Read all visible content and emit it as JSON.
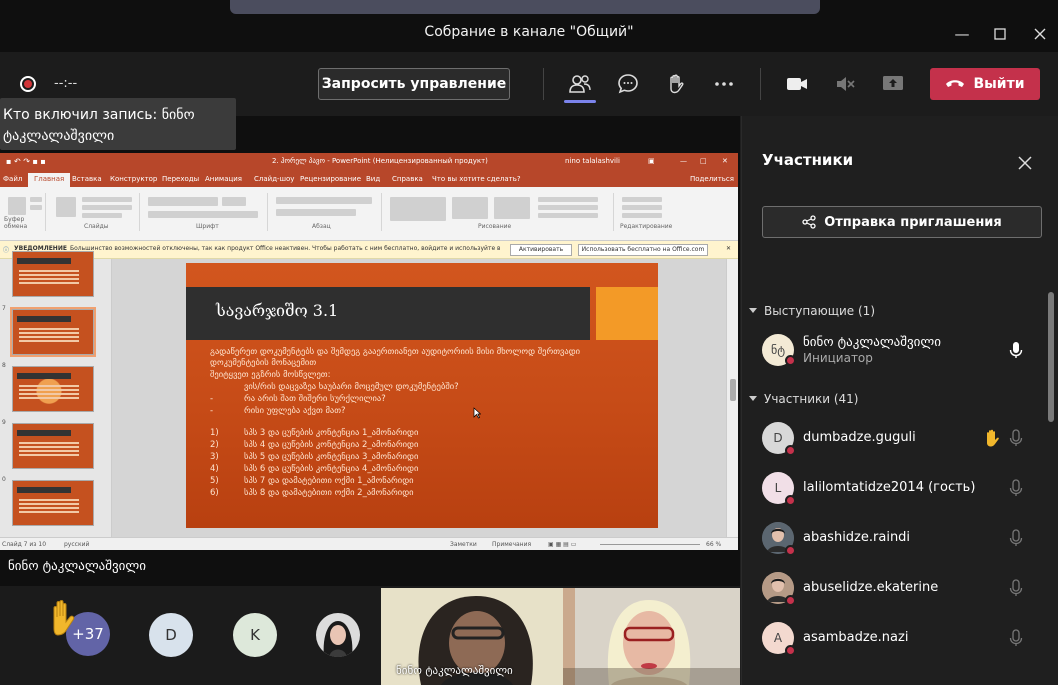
{
  "window": {
    "title": "Собрание в канале \"Общий\""
  },
  "toolbar": {
    "timer": "--:--",
    "request_control_label": "Запросить управление",
    "leave_label": "Выйти",
    "accent": "#7b83eb",
    "leave_color": "#c4314b"
  },
  "recording_tip": {
    "line1": "Кто включил запись: ნინო",
    "line2": "ტაკლალაშვილი"
  },
  "ppt": {
    "window_title": "2. ჰორელ პავო - PowerPoint (Нелицензированный продукт)",
    "user": "nino talalashvili",
    "tabs": [
      "Файл",
      "Главная",
      "Вставка",
      "Конструктор",
      "Переходы",
      "Анимация",
      "Слайд-шоу",
      "Рецензирование",
      "Вид",
      "Справка",
      "Что вы хотите сделать?"
    ],
    "share_label": "Поделиться",
    "ribbon_groups": [
      "Буфер обмена",
      "Слайды",
      "Шрифт",
      "Абзац",
      "Рисование",
      "Редактирование"
    ],
    "notice_label": "УВЕДОМЛЕНИЕ",
    "notice_text": "Большинство возможностей отключены, так как продукт Office неактивен. Чтобы работать с ним бесплатно, войдите и используйте веб-версию.",
    "activate_btn": "Активировать",
    "free_btn": "Использовать бесплатно на Office.com",
    "thumb_numbers": [
      "7",
      "8",
      "9",
      "0"
    ],
    "slide_title": "სავარჯიშო 3.1",
    "slide_lines": [
      "გადაწერეთ დოკუმენტებს და შემდეგ გააერთიანეთ აუდიტორიის მისი მხოლოდ შერთვადი",
      "დოკუმენტების მონაცემით",
      "შეიტყვეთ ეგზრის მოსწვლეთ:",
      "ვის/რის დაცვაზეა ხაუბარი მოცემულ დოკუმენტებში?",
      "რა არის შათ შიშერი სურქლილია?",
      "რისი უფლება აქვთ მათ?"
    ],
    "slide_bullets": [
      "-",
      "-"
    ],
    "slide_numbers": [
      "1)",
      "2)",
      "3)",
      "4)",
      "5)",
      "6)"
    ],
    "slide_items": [
      "სპს 3 და ცუწების კონტენცია 1_ამონარიდი",
      "სპს 4 და ცუწების კონტენცია 2_ამონარიდი",
      "სპს 5 და ცუწების კონტენცია 3_ამონარიდი",
      "სპს 6 და ცუწების კონტენცია 4_ამონარიდი",
      "სპს 7 და დამატებითი ოქმი 1_ამონარიდი",
      "სპს 8 და დამატებითი ოქმი 2_ამონარიდი"
    ],
    "status_slide": "Слайд 7 из 10",
    "status_lang": "русский",
    "status_notes": "Заметки",
    "status_comments": "Примечания",
    "status_zoom": "66 %"
  },
  "presenter_name": "ნინო ტაკლალაშვილი",
  "bottom_row": {
    "more_count": "+37",
    "avatars": [
      "D",
      "K"
    ],
    "video_name": "ნინო ტაკლალაშვილი"
  },
  "panel": {
    "title": "Участники",
    "invite_label": "Отправка приглашения",
    "presenters_header": "Выступающие (1)",
    "attendees_header": "Участники (41)",
    "presenter": {
      "initials": "ნტ",
      "name": "ნინო ტაკლალაშვილი",
      "role": "Инициатор"
    },
    "attendees": [
      {
        "initials": "D",
        "name": "dumbadze.guguli",
        "hand": true,
        "color": "#d8d8d8"
      },
      {
        "initials": "L",
        "name": "lalilomtatidze2014 (гость)",
        "hand": false,
        "color": "#f1dfe7"
      },
      {
        "initials": "",
        "name": "abashidze.raindi",
        "hand": false,
        "color": "#5b6670"
      },
      {
        "initials": "",
        "name": "abuselidze.ekaterine",
        "hand": false,
        "color": "#b59a86"
      },
      {
        "initials": "A",
        "name": "asambadze.nazi",
        "hand": false,
        "color": "#f3d9cf"
      }
    ]
  }
}
